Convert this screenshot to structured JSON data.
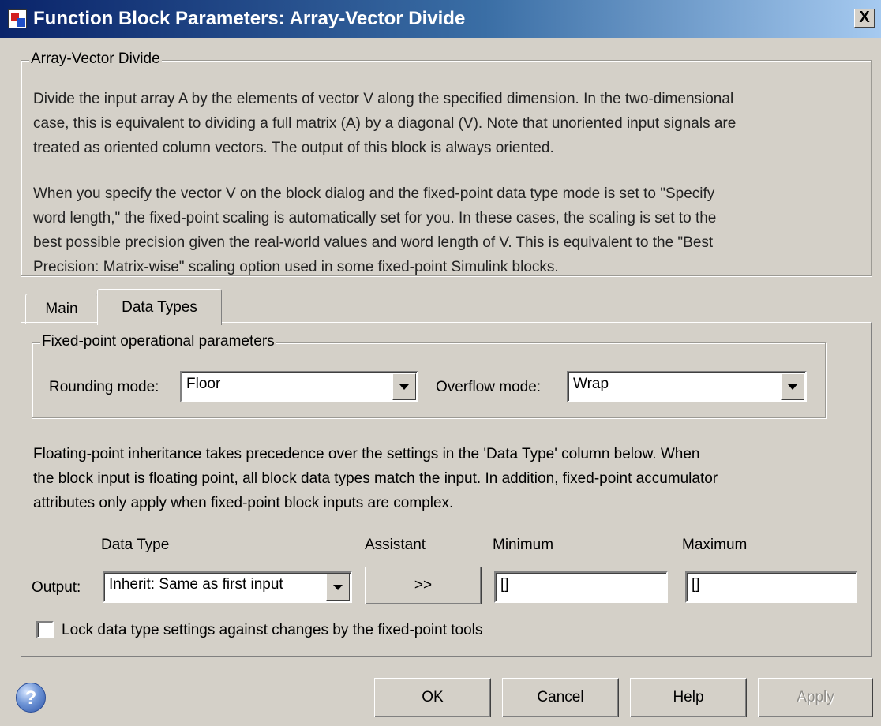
{
  "window": {
    "title": "Function Block Parameters: Array-Vector Divide",
    "close_glyph": "X"
  },
  "description_group": {
    "legend": "Array-Vector Divide",
    "paragraph1": "Divide the input array A by the elements of vector V along the specified dimension.  In the two-dimensional\ncase, this is equivalent to dividing a full matrix (A) by a diagonal (V). Note that unoriented input signals are\ntreated as oriented column vectors. The output of this block is always oriented.",
    "paragraph2": "When you specify the vector V on the block dialog and the fixed-point data type mode is set to \"Specify\nword length,\" the fixed-point scaling is automatically set for you. In these cases, the scaling is set to the\nbest possible precision given the real-world values and word length of V. This is equivalent to the \"Best\nPrecision: Matrix-wise\" scaling option used in some fixed-point Simulink blocks."
  },
  "tabs": [
    {
      "label": "Main",
      "selected": false
    },
    {
      "label": "Data Types",
      "selected": true
    }
  ],
  "fixed_point_group": {
    "legend": "Fixed-point operational parameters",
    "rounding_label": "Rounding mode:",
    "rounding_value": "Floor",
    "overflow_label": "Overflow mode:",
    "overflow_value": "Wrap"
  },
  "inheritance_text": "Floating-point inheritance takes precedence over the settings in the 'Data Type' column below. When\nthe block input is floating point, all block data types match the input. In addition, fixed-point accumulator\nattributes only apply when fixed-point block inputs are complex.",
  "table": {
    "headers": {
      "data_type": "Data Type",
      "assistant": "Assistant",
      "minimum": "Minimum",
      "maximum": "Maximum"
    },
    "output_row": {
      "label": "Output:",
      "data_type_value": "Inherit: Same as first input",
      "assistant_button": ">>",
      "minimum_value": "[]",
      "maximum_value": "[]"
    }
  },
  "lock_checkbox": {
    "label": "Lock data type settings against changes by the fixed-point tools",
    "checked": false
  },
  "help_icon_glyph": "?",
  "buttons": {
    "ok": "OK",
    "cancel": "Cancel",
    "help": "Help",
    "apply": "Apply"
  },
  "colors": {
    "dialog_bg": "#d4d0c8",
    "title_start": "#0a246a",
    "title_end": "#a6caf0",
    "disabled_text": "#8f8d88"
  }
}
